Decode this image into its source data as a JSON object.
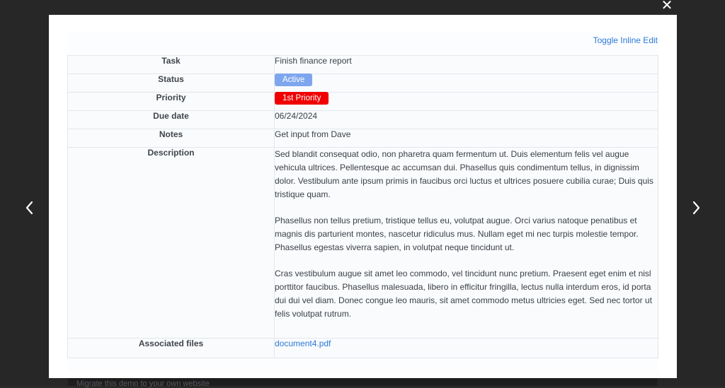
{
  "modal": {
    "close_label": "✕",
    "toggle_inline_edit": "Toggle Inline Edit"
  },
  "nav": {
    "prev_icon": "chevron-left-icon",
    "next_icon": "chevron-right-icon"
  },
  "record": {
    "task_label": "Task",
    "task_value": "Finish finance report",
    "status_label": "Status",
    "status_value": "Active",
    "priority_label": "Priority",
    "priority_value": "1st Priority",
    "due_label": "Due date",
    "due_value": "06/24/2024",
    "notes_label": "Notes",
    "notes_value": "Get input from Dave",
    "description_label": "Description",
    "description_paragraphs": [
      "Sed blandit consequat odio, non pharetra quam fermentum ut. Duis elementum felis vel augue vehicula ultrices. Pellentesque ac accumsan dui. Phasellus quis condimentum tellus, in dignissim dolor. Vestibulum ante ipsum primis in faucibus orci luctus et ultrices posuere cubilia curae; Duis quis tristique quam.",
      "Phasellus non tellus pretium, tristique tellus eu, volutpat augue. Orci varius natoque penatibus et magnis dis parturient montes, nascetur ridiculus mus. Nullam eget mi nec turpis molestie tempor. Phasellus egestas viverra sapien, in volutpat neque tincidunt ut.",
      "Cras vestibulum augue sit amet leo commodo, vel tincidunt nunc pretium. Praesent eget enim et nisl porttitor faucibus. Phasellus malesuada, libero in efficitur fringilla, lectus nulla interdum eros, id porta dui dui vel diam. Donec congue leo mauris, sit amet commodo metus ultricies eget. Sed nec tortor ut felis volutpat rutrum."
    ],
    "files_label": "Associated files",
    "files_value": "document4.pdf"
  },
  "colors": {
    "status_badge": "#7ea6ee",
    "priority_badge": "#f00000",
    "link": "#2d7ad6"
  },
  "background": {
    "partial_text": "Migrate this demo to your own website"
  }
}
